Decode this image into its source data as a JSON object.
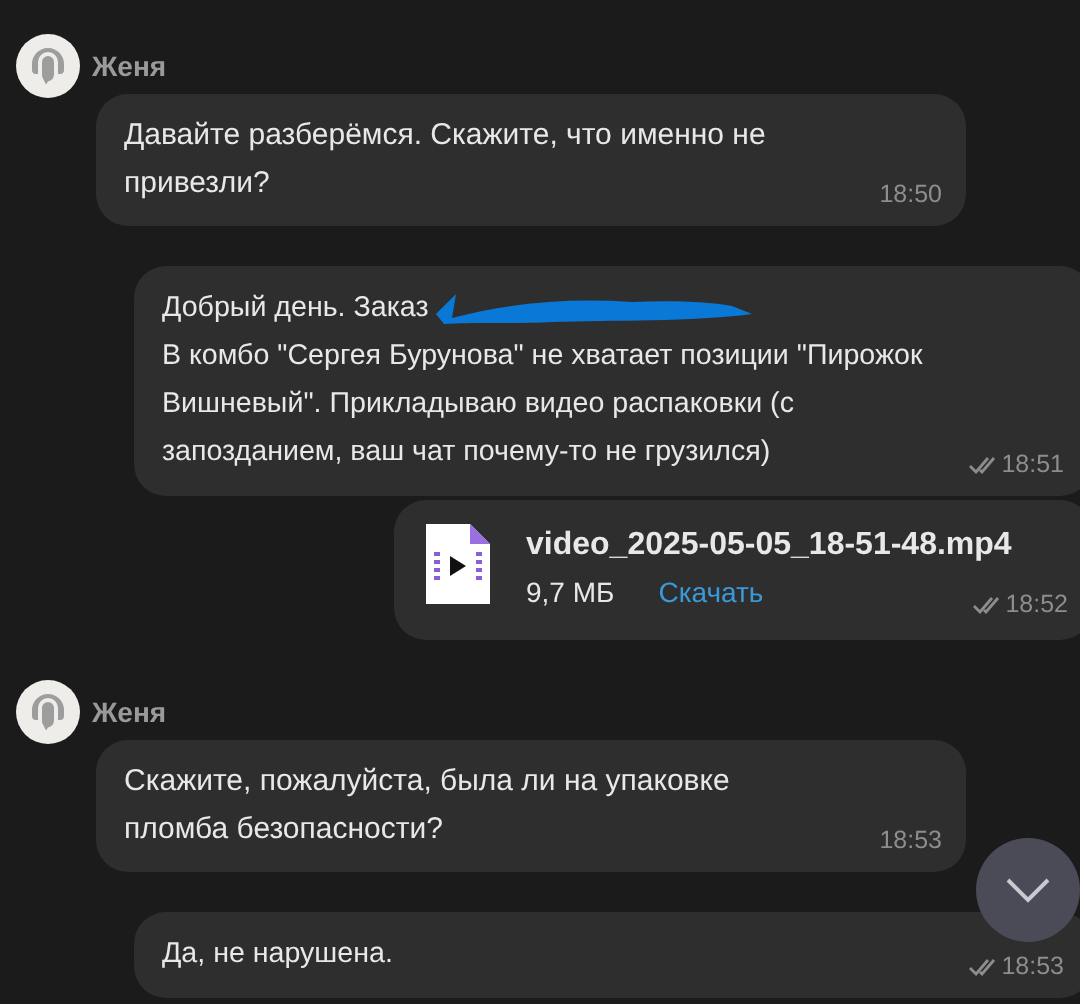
{
  "messages": [
    {
      "kind": "incoming",
      "sender": "Женя",
      "paragraphs": [
        "Давайте разберёмся. Скажите, что именно не привезли?"
      ],
      "time": "18:50"
    },
    {
      "kind": "outgoing",
      "paragraphs": [
        "Добрый день. Заказ",
        "В комбо \"Сергея Бурунова\" не хватает позиции \"Пирожок Вишневый\". Прикладываю видео распаковки (с запозданием, ваш чат почему-то не грузился)"
      ],
      "redacted_after_first": true,
      "time": "18:51",
      "read": true
    },
    {
      "kind": "file",
      "file_name": "video_2025-05-05_18-51-48.mp4",
      "size": "9,7 МБ",
      "action": "Скачать",
      "time": "18:52",
      "read": true
    },
    {
      "kind": "incoming",
      "sender": "Женя",
      "paragraphs": [
        "Скажите, пожалуйста, была ли на упаковке пломба безопасности?"
      ],
      "time": "18:53"
    },
    {
      "kind": "outgoing",
      "paragraphs": [
        "Да, не нарушена."
      ],
      "time": "18:53",
      "read": true
    }
  ],
  "scroll_down_button": {
    "visible": true
  }
}
